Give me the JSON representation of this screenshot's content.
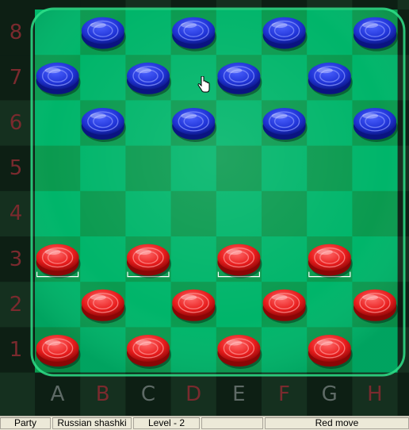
{
  "board": {
    "files": [
      "A",
      "B",
      "C",
      "D",
      "E",
      "F",
      "G",
      "H"
    ],
    "ranks": [
      "8",
      "7",
      "6",
      "5",
      "4",
      "3",
      "2",
      "1"
    ],
    "colors": {
      "dark_square": "#0a9a4f",
      "light_square": "#00b56a",
      "blue_piece": "#1f33d6",
      "red_piece": "#e81c1c",
      "label_color": "#7a2a2e"
    },
    "pieces": [
      {
        "side": "blue",
        "square": "B8"
      },
      {
        "side": "blue",
        "square": "D8"
      },
      {
        "side": "blue",
        "square": "F8"
      },
      {
        "side": "blue",
        "square": "H8"
      },
      {
        "side": "blue",
        "square": "A7"
      },
      {
        "side": "blue",
        "square": "C7"
      },
      {
        "side": "blue",
        "square": "E7"
      },
      {
        "side": "blue",
        "square": "G7"
      },
      {
        "side": "blue",
        "square": "B6"
      },
      {
        "side": "blue",
        "square": "D6"
      },
      {
        "side": "blue",
        "square": "F6"
      },
      {
        "side": "blue",
        "square": "H6"
      },
      {
        "side": "red",
        "square": "A3"
      },
      {
        "side": "red",
        "square": "C3"
      },
      {
        "side": "red",
        "square": "E3"
      },
      {
        "side": "red",
        "square": "G3"
      },
      {
        "side": "red",
        "square": "B2"
      },
      {
        "side": "red",
        "square": "D2"
      },
      {
        "side": "red",
        "square": "F2"
      },
      {
        "side": "red",
        "square": "H2"
      },
      {
        "side": "red",
        "square": "A1"
      },
      {
        "side": "red",
        "square": "C1"
      },
      {
        "side": "red",
        "square": "E1"
      },
      {
        "side": "red",
        "square": "G1"
      }
    ],
    "movable_highlight": [
      "A3",
      "C3",
      "E3",
      "G3"
    ],
    "cursor_icon": "hand-pointer-icon"
  },
  "statusbar": {
    "party": "Party",
    "game_type": "Russian shashki",
    "level": "Level - 2",
    "empty": "",
    "status": "Red move"
  }
}
